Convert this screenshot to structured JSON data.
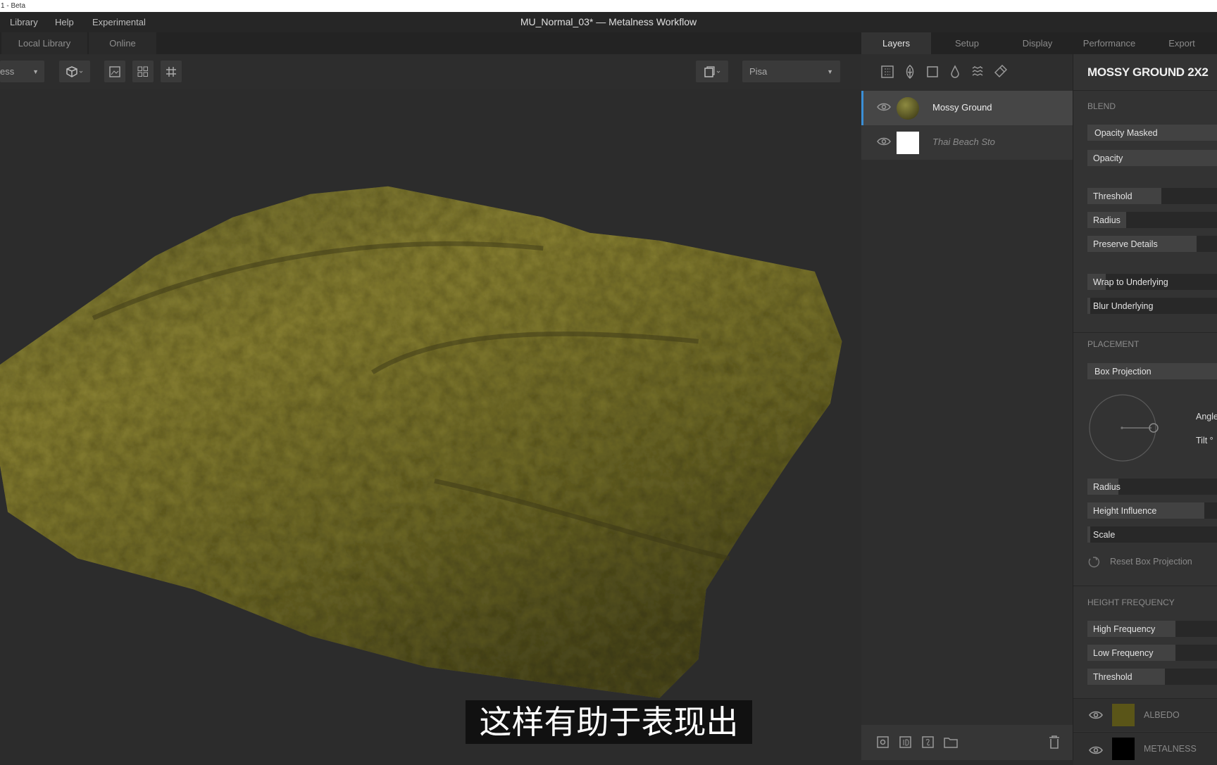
{
  "os_bar": {
    "title": "1 - Beta"
  },
  "menu": {
    "items": [
      "Library",
      "Help",
      "Experimental"
    ],
    "window_title": "MU_Normal_03* — Metalness Workflow"
  },
  "library_tabs": [
    "Local Library",
    "Online"
  ],
  "toolbar": {
    "view_mode": "ess",
    "environment": "Pisa",
    "icons": [
      "cube-icon",
      "image-icon",
      "grid-2x2-icon",
      "grid-icon",
      "camera-icon"
    ]
  },
  "right_tabs": {
    "items": [
      "Layers",
      "Setup",
      "Display",
      "Performance",
      "Export"
    ],
    "active": "Layers"
  },
  "layers": {
    "tool_icons": [
      "table-icon",
      "leaf-icon",
      "square-icon",
      "drop-icon",
      "waves-icon",
      "brush-icon"
    ],
    "items": [
      {
        "name": "Mossy Ground",
        "selected": true,
        "italic": false
      },
      {
        "name": "Thai Beach Sto",
        "selected": false,
        "italic": true
      }
    ],
    "bottom_icons": [
      "add-layer-icon",
      "id-mask-icon",
      "script-icon",
      "folder-icon",
      "trash-icon"
    ]
  },
  "properties": {
    "title": "MOSSY GROUND 2X2",
    "blend": {
      "heading": "BLEND",
      "mode": "Opacity Masked",
      "opacity_label": "Opacity",
      "sliders": [
        {
          "label": "Threshold",
          "value": 0.57
        },
        {
          "label": "Radius",
          "value": 0.3
        },
        {
          "label": "Preserve Details",
          "value": 0.84
        },
        {
          "label": "Wrap to Underlying",
          "value": 0.14
        },
        {
          "label": "Blur Underlying",
          "value": 0.02
        }
      ]
    },
    "placement": {
      "heading": "PLACEMENT",
      "mode": "Box Projection",
      "angle_label": "Angle",
      "tilt_label": "Tilt °",
      "sliders": [
        {
          "label": "Radius",
          "value": 0.24
        },
        {
          "label": "Height Influence",
          "value": 0.9
        },
        {
          "label": "Scale",
          "value": 0.02
        }
      ],
      "reset_label": "Reset Box Projection"
    },
    "height_frequency": {
      "heading": "HEIGHT FREQUENCY",
      "sliders": [
        {
          "label": "High Frequency",
          "value": 0.68
        },
        {
          "label": "Low Frequency",
          "value": 0.68
        },
        {
          "label": "Threshold",
          "value": 0.6
        }
      ]
    },
    "channels": [
      {
        "name": "ALBEDO",
        "color": "#5a5518"
      },
      {
        "name": "METALNESS",
        "color": "#000000"
      }
    ]
  },
  "subtitle": "这样有助于表现出",
  "colors": {
    "accent": "#3b8fd6",
    "panel": "#333333",
    "viewport": "#2c2c2c"
  }
}
